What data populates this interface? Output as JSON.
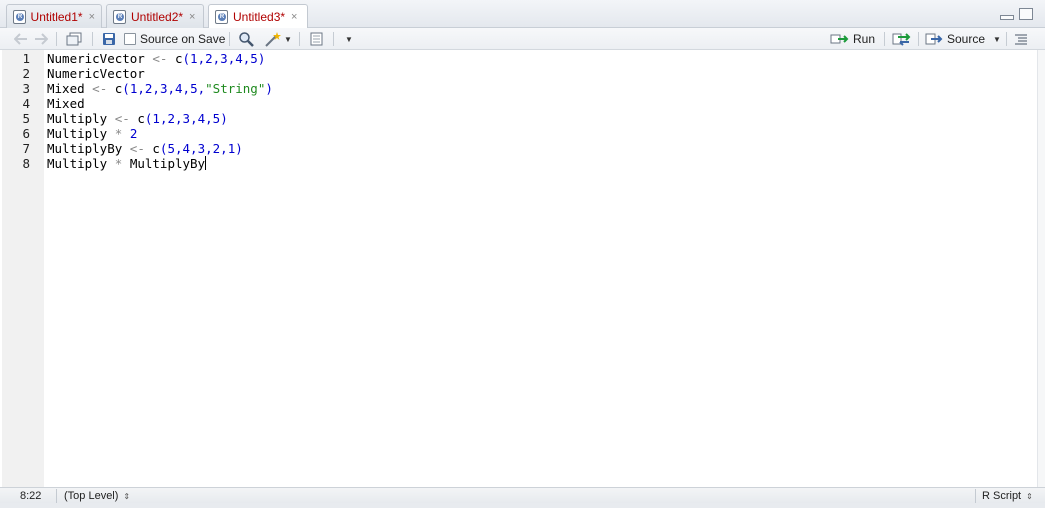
{
  "tabs": [
    {
      "label": "Untitled1*",
      "close": "×"
    },
    {
      "label": "Untitled2*",
      "close": "×"
    },
    {
      "label": "Untitled3*",
      "close": "×"
    }
  ],
  "toolbar": {
    "source_on_save_label": "Source on Save",
    "run_label": "Run",
    "source_label": "Source"
  },
  "editor": {
    "line_numbers": [
      "1",
      "2",
      "3",
      "4",
      "5",
      "6",
      "7",
      "8"
    ],
    "lines": [
      "NumericVector <- c(1,2,3,4,5)",
      "NumericVector",
      "Mixed <- c(1,2,3,4,5,\"String\")",
      "Mixed",
      "Multiply <- c(1,2,3,4,5)",
      "Multiply * 2",
      "MultiplyBy <- c(5,4,3,2,1)",
      "Multiply * MultiplyBy"
    ]
  },
  "statusbar": {
    "position": "8:22",
    "scope": "(Top Level)",
    "file_type": "R Script"
  },
  "colors": {
    "tab_text": "#b00000",
    "number": "#0000d0",
    "string": "#1f8a1f",
    "operator": "#888888"
  }
}
